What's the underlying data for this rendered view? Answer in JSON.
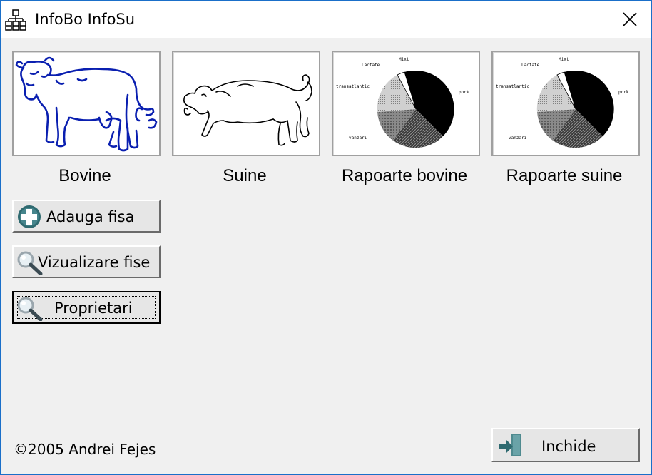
{
  "window": {
    "title": "InfoBo InfoSu"
  },
  "tiles": [
    {
      "label": "Bovine"
    },
    {
      "label": "Suine"
    },
    {
      "label": "Rapoarte bovine"
    },
    {
      "label": "Rapoarte suine"
    }
  ],
  "pie_labels": [
    "Mixt",
    "Lactate",
    "transatlantic",
    "pork",
    "vanzari"
  ],
  "buttons": {
    "add": "Adauga fisa",
    "view": "Vizualizare fise",
    "owners": "Proprietari",
    "close": "Inchide"
  },
  "footer": {
    "copyright": "©2005 Andrei Fejes"
  },
  "colors": {
    "border_blue": "#1a6fc9",
    "cow_blue": "#0a1fb0"
  }
}
